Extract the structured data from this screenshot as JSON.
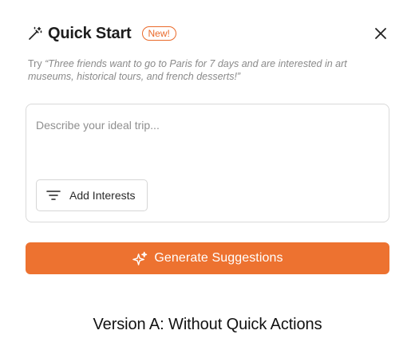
{
  "dialog": {
    "title": "Quick Start",
    "badge": "New!",
    "hint_prefix": "Try ",
    "hint_example": "“Three friends want to go to Paris for 7 days and are interested in art museums, historical tours, and french desserts!”"
  },
  "trip_input": {
    "value": "",
    "placeholder": "Describe your ideal trip..."
  },
  "interests_button": {
    "label": "Add Interests",
    "icon": "filter-icon"
  },
  "generate_button": {
    "label": "Generate Suggestions",
    "icon": "sparkle-icon"
  },
  "caption": "Version A: Without Quick Actions",
  "colors": {
    "accent": "#ed7230",
    "border": "#d9d9d9",
    "hint_text": "#8a8a8a"
  }
}
